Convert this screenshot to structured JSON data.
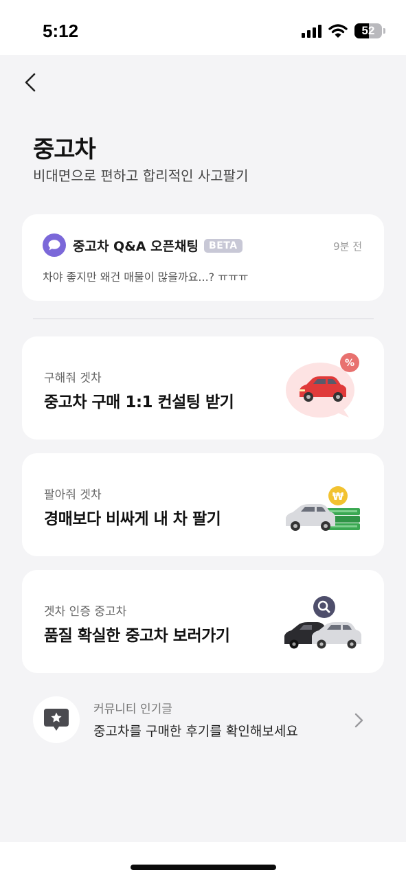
{
  "status_bar": {
    "time": "5:12",
    "battery_level": "52",
    "battery_fraction": 0.52
  },
  "header": {
    "back_icon": "chevron-left-icon",
    "title": "중고차",
    "subtitle": "비대면으로 편하고 합리적인 사고팔기"
  },
  "chat_card": {
    "icon": "chat-bubble-icon",
    "title": "중고차 Q&A 오픈채팅",
    "badge": "BETA",
    "time": "9분 전",
    "message": "차야 좋지만 왜건 매물이 많을까요...? ㅠㅠㅠ"
  },
  "services": [
    {
      "label": "구해줘 겟차",
      "title": "중고차 구매 1:1 컨설팅 받기",
      "icon": "red-car-percent-icon"
    },
    {
      "label": "팔아줘 겟차",
      "title": "경매보다 비싸게 내 차 팔기",
      "icon": "car-money-won-icon"
    },
    {
      "label": "겟차 인증 중고차",
      "title": "품질 확실한 중고차 보러가기",
      "icon": "cars-search-icon"
    }
  ],
  "community": {
    "icon": "star-chat-icon",
    "label": "커뮤니티 인기글",
    "text": "중고차를 구매한 후기를 확인해보세요",
    "chevron_icon": "chevron-right-icon"
  },
  "colors": {
    "background": "#f4f4f6",
    "card": "#ffffff",
    "accent_purple": "#7b68d9",
    "badge": "#c8c8d6",
    "red": "#e63946",
    "green": "#3aa852",
    "gold": "#f2c230"
  }
}
